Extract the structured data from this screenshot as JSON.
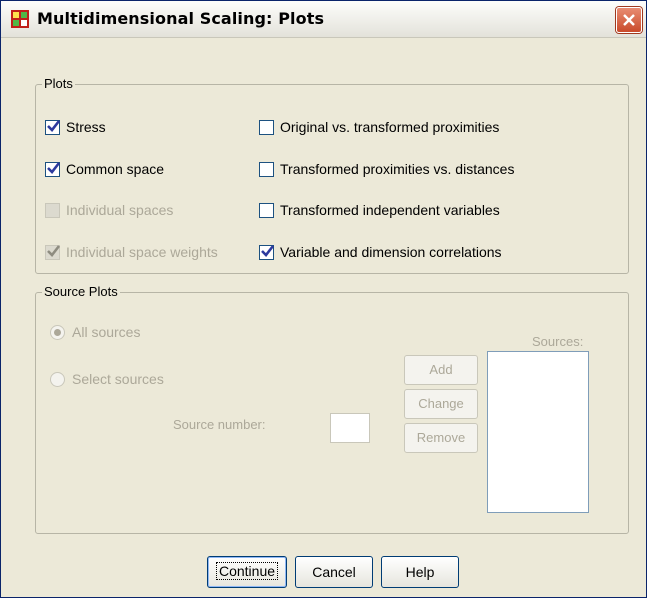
{
  "window": {
    "title": "Multidimensional Scaling: Plots"
  },
  "plots": {
    "group_label": "Plots",
    "items": [
      {
        "label": "Stress",
        "checked": true,
        "enabled": true
      },
      {
        "label": "Common space",
        "checked": true,
        "enabled": true
      },
      {
        "label": "Individual spaces",
        "checked": false,
        "enabled": false
      },
      {
        "label": "Individual space weights",
        "checked": true,
        "enabled": false
      },
      {
        "label": "Original vs. transformed proximities",
        "checked": false,
        "enabled": true
      },
      {
        "label": "Transformed proximities vs. distances",
        "checked": false,
        "enabled": true
      },
      {
        "label": "Transformed independent variables",
        "checked": false,
        "enabled": true
      },
      {
        "label": "Variable and dimension correlations",
        "checked": true,
        "enabled": true
      }
    ]
  },
  "source_plots": {
    "group_label": "Source Plots",
    "all_sources_label": "All sources",
    "select_sources_label": "Select sources",
    "selected_option": "All sources",
    "source_number_label": "Source number:",
    "source_number_value": "",
    "sources_label": "Sources:",
    "add_label": "Add",
    "change_label": "Change",
    "remove_label": "Remove"
  },
  "buttons": {
    "continue_label": "Continue",
    "cancel_label": "Cancel",
    "help_label": "Help"
  },
  "colors": {
    "check": "#2d3a9e",
    "dialog_bg": "#ece9d8",
    "close_button": "#c94a2a",
    "listbox_border": "#7f9db9"
  },
  "icons": {
    "app": "spss-grid-icon",
    "close": "close-icon"
  }
}
